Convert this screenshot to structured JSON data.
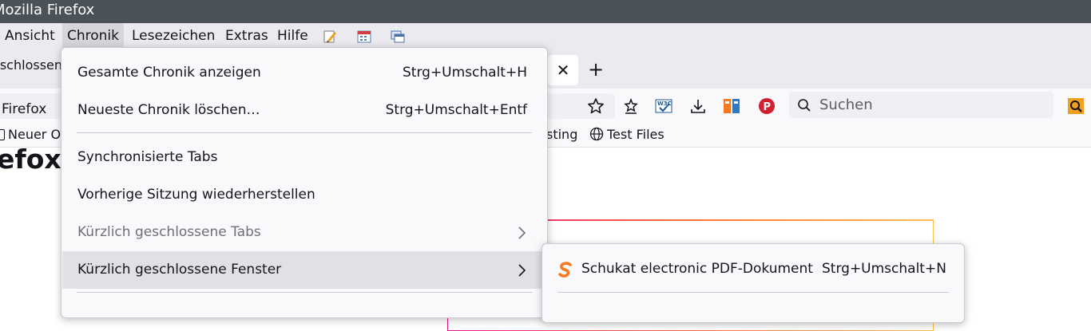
{
  "window": {
    "title": "Mozilla Firefox"
  },
  "menubar": {
    "items": [
      {
        "label": "Ansicht"
      },
      {
        "label": "Chronik"
      },
      {
        "label": "Lesezeichen"
      },
      {
        "label": "Extras"
      },
      {
        "label": "Hilfe"
      }
    ],
    "toolbar_icons": [
      "edit-icon",
      "calendar-icon",
      "window-icon"
    ]
  },
  "tabs": {
    "partial_label": "eschlossen",
    "close_glyph": "✕",
    "new_tab_glyph": "+"
  },
  "navbar": {
    "url_text": "Firefox",
    "search_placeholder": "Suchen",
    "icons": [
      "bookmark-star-icon",
      "reading-list-icon",
      "w3c-validator-icon",
      "download-icon",
      "extension-icon",
      "pocket-icon",
      "magnifier-extension-icon"
    ]
  },
  "bookmarks": {
    "left_partial": "Neuer O",
    "testing_partial": "sting",
    "test_files": "Test Files"
  },
  "content": {
    "title_partial": "efox"
  },
  "chronik_menu": {
    "items": [
      {
        "label": "Gesamte Chronik anzeigen",
        "shortcut": "Strg+Umschalt+H"
      },
      {
        "label": "Neueste Chronik löschen…",
        "shortcut": "Strg+Umschalt+Entf"
      },
      {
        "label": "Synchronisierte Tabs"
      },
      {
        "label": "Vorherige Sitzung wiederherstellen"
      },
      {
        "label": "Kürzlich geschlossene Tabs",
        "disabled": true,
        "submenu": true
      },
      {
        "label": "Kürzlich geschlossene Fenster",
        "hovered": true,
        "submenu": true
      }
    ]
  },
  "submenu": {
    "items": [
      {
        "label": "Schukat electronic PDF-Dokument",
        "shortcut": "Strg+Umschalt+N",
        "icon": "schukat-logo-icon",
        "icon_color": "#f47920"
      }
    ]
  },
  "colors": {
    "titlebar": "#4a5157",
    "menubar": "#ebebef",
    "hover": "#e0e0e6",
    "accent_gradient": [
      "#e31587",
      "#ff7139",
      "#ffbd4f"
    ]
  }
}
